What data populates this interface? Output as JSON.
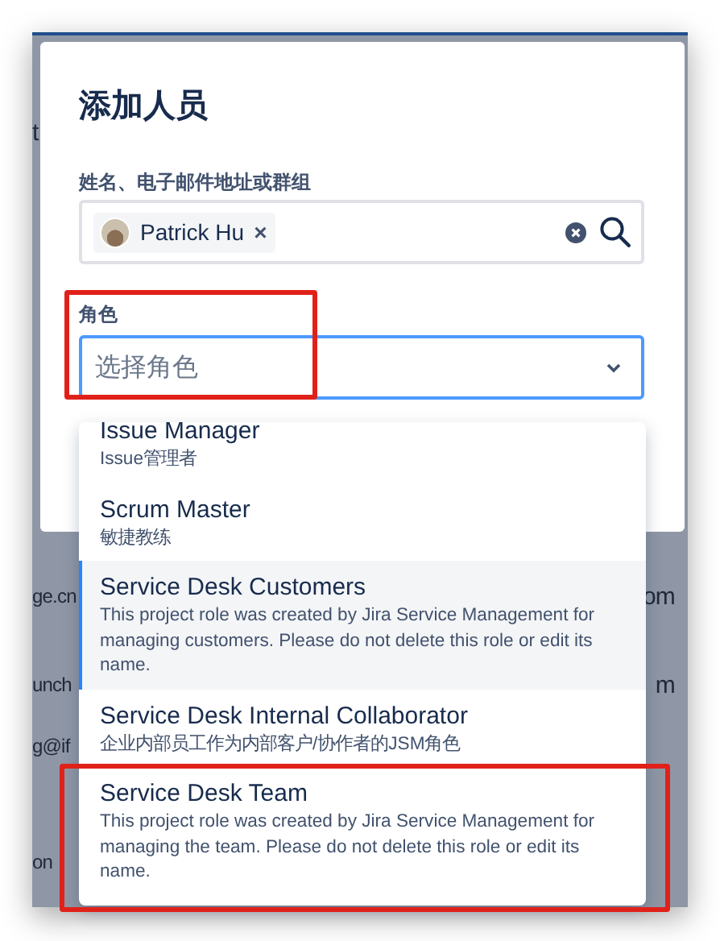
{
  "background_fragments": [
    "t",
    "ge.cn",
    "om",
    "unch",
    "m",
    "g@if",
    "on"
  ],
  "dialog": {
    "title": "添加人员",
    "people_field": {
      "label": "姓名、电子邮件地址或群组",
      "chips": [
        {
          "name": "Patrick Hu",
          "remove": "×"
        }
      ]
    },
    "role_field": {
      "label": "角色",
      "placeholder": "选择角色",
      "highlighted": true
    }
  },
  "role_options": [
    {
      "title": "Issue Manager",
      "description": "Issue管理者",
      "selected": false,
      "highlighted": false
    },
    {
      "title": "Scrum Master",
      "description": "敏捷教练",
      "selected": false,
      "highlighted": false
    },
    {
      "title": "Service Desk Customers",
      "description": "This project role was created by Jira Service Management for managing customers. Please do not delete this role or edit its name.",
      "selected": true,
      "highlighted": false
    },
    {
      "title": "Service Desk Internal Collaborator",
      "description": "企业内部员工作为内部客户/协作者的JSM角色",
      "selected": false,
      "highlighted": false
    },
    {
      "title": "Service Desk Team",
      "description": "This project role was created by Jira Service Management for managing the team. Please do not delete this role or edit its name.",
      "selected": false,
      "highlighted": true
    }
  ]
}
